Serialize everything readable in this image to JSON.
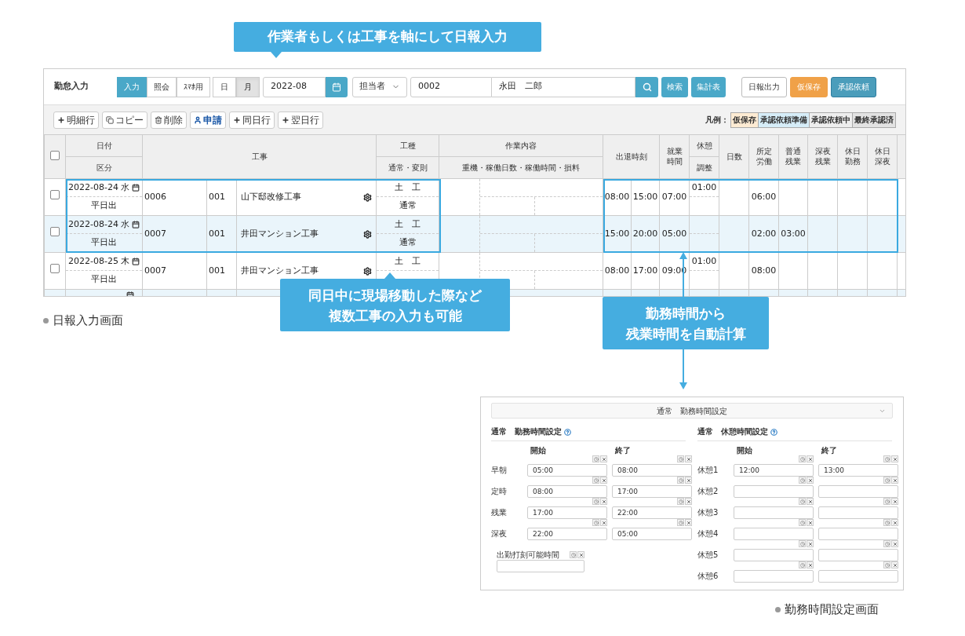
{
  "headline": "作業者もしくは工事を軸にして日報入力",
  "daily_screen": {
    "title": "勤怠入力",
    "mode_tabs": [
      {
        "label": "入力",
        "selected": true
      },
      {
        "label": "照会",
        "selected": false
      },
      {
        "label": "ｽﾏﾎ用",
        "selected": false
      }
    ],
    "period_tabs": [
      {
        "label": "日",
        "selected": false
      },
      {
        "label": "月",
        "selected": true
      }
    ],
    "month": "2022-08",
    "filter_select": "担当者",
    "code": "0002",
    "name": "永田　二郎",
    "search_buttons": [
      "検索",
      "集計表"
    ],
    "actions": [
      {
        "label": "日報出力",
        "kind": "plain"
      },
      {
        "label": "仮保存",
        "kind": "warning"
      },
      {
        "label": "承認依頼",
        "kind": "primary"
      }
    ],
    "row_tools": [
      {
        "label": "明細行",
        "kind": "plus"
      },
      {
        "label": "コピー",
        "kind": "copy"
      },
      {
        "label": "削除",
        "kind": "trash"
      },
      {
        "label": "申請",
        "kind": "user"
      },
      {
        "label": "同日行",
        "kind": "plus"
      },
      {
        "label": "翌日行",
        "kind": "plus"
      }
    ],
    "legend_label": "凡例：",
    "legend": [
      {
        "label": "仮保存",
        "color": "#fdebd3"
      },
      {
        "label": "承認依頼準備",
        "color": "#d6edf8"
      },
      {
        "label": "承認依頼中",
        "color": "#eeeeee"
      },
      {
        "label": "最終承認済",
        "color": "#e2e2e2"
      }
    ],
    "header": {
      "checked": false,
      "date": "日付",
      "kubun": "区分",
      "project": "工事",
      "trade": "工種",
      "trade_sub": "通常・変則",
      "work": "作業内容",
      "work_sub": "重機・稼働日数・稼働時間・損料",
      "inout": "出退時刻",
      "worktime": "就業時間",
      "break": "休憩",
      "break_sub": "調整",
      "days": "日数",
      "sched": "所定労働",
      "overtime": "普通残業",
      "night": "深夜残業",
      "holiday": "休日勤務",
      "holiday_night": "休日深夜"
    },
    "rows": [
      {
        "checked": false,
        "highlighted": true,
        "date": "2022-08-24 水",
        "kubun": "平日出",
        "code": "0006",
        "sub": "001",
        "project": "山下邸改修工事",
        "trade": "土　工",
        "type": "通常",
        "in": "08:00",
        "out": "15:00",
        "work": "07:00",
        "break": "01:00",
        "sched": "06:00"
      },
      {
        "checked": false,
        "highlighted": true,
        "date": "2022-08-24 水",
        "kubun": "平日出",
        "code": "0007",
        "sub": "001",
        "project": "井田マンション工事",
        "trade": "土　工",
        "type": "通常",
        "in": "15:00",
        "out": "20:00",
        "work": "05:00",
        "sched": "02:00",
        "overtime": "03:00"
      },
      {
        "checked": false,
        "highlighted": false,
        "date": "2022-08-25 木",
        "kubun": "平日出",
        "code": "0007",
        "sub": "001",
        "project": "井田マンション工事",
        "trade": "土　工",
        "in": "08:00",
        "out": "17:00",
        "work": "09:00",
        "break": "01:00",
        "sched": "08:00"
      }
    ]
  },
  "screen_caption": "日報入力画面",
  "callouts": [
    {
      "lines": [
        "同日中に現場移動した際など",
        "複数工事の入力も可能"
      ]
    },
    {
      "lines": [
        "勤務時間から",
        "残業時間を自動計算"
      ]
    }
  ],
  "settings_screen": {
    "accordion_title": "通常　勤務時間設定",
    "work_section": {
      "title": "通常　勤務時間設定",
      "col_labels": [
        "開始",
        "終了"
      ],
      "rows": [
        {
          "label": "早朝",
          "start": "05:00",
          "end": "08:00"
        },
        {
          "label": "定時",
          "start": "08:00",
          "end": "17:00"
        },
        {
          "label": "残業",
          "start": "17:00",
          "end": "22:00"
        },
        {
          "label": "深夜",
          "start": "22:00",
          "end": "05:00"
        }
      ],
      "extra_field": "出勤打刻可能時間"
    },
    "break_section": {
      "title": "通常　休憩時間設定",
      "col_labels": [
        "開始",
        "終了"
      ],
      "rows": [
        {
          "label": "休憩1",
          "start": "12:00",
          "end": "13:00"
        },
        {
          "label": "休憩2"
        },
        {
          "label": "休憩3"
        },
        {
          "label": "休憩4"
        },
        {
          "label": "休憩5"
        },
        {
          "label": "休憩6"
        }
      ]
    }
  },
  "settings_caption": "勤務時間設定画面"
}
